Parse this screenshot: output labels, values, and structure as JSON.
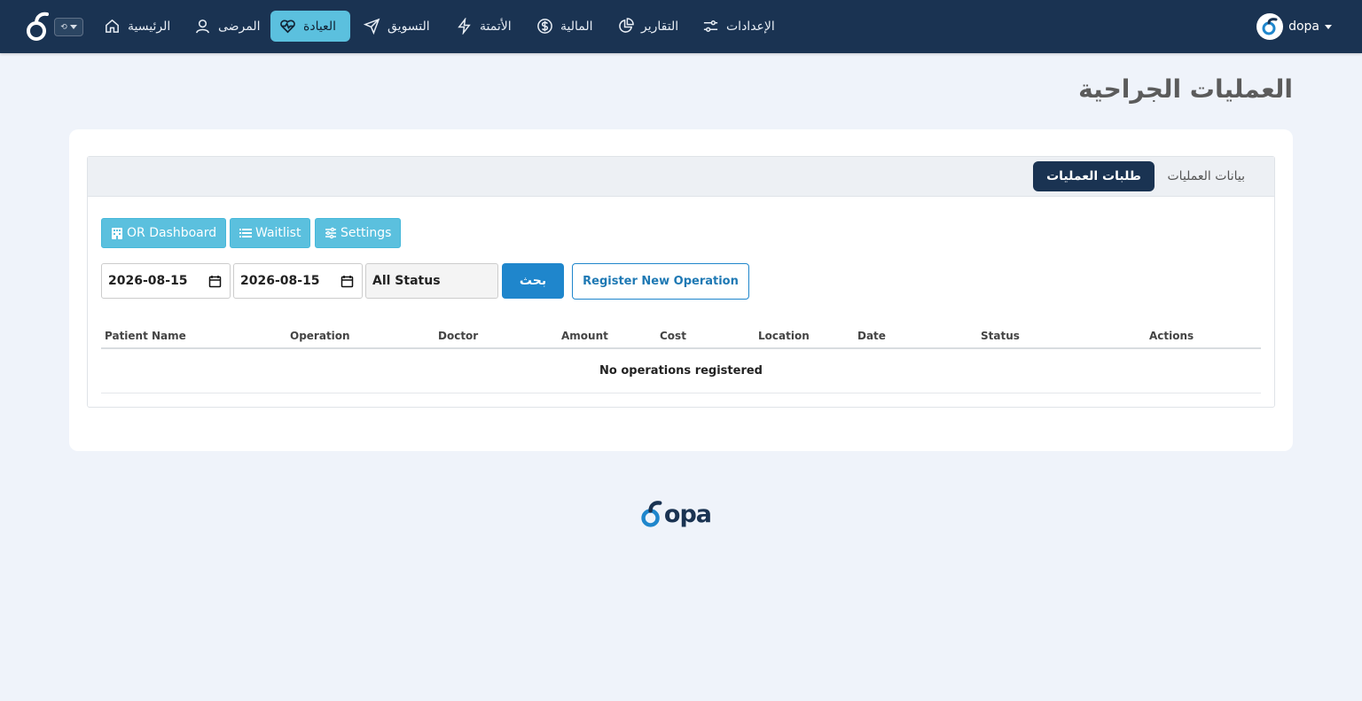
{
  "navbar": {
    "items": [
      {
        "label": "الإعدادات",
        "icon": "sliders-icon"
      },
      {
        "label": "التقارير",
        "icon": "pie-chart-icon"
      },
      {
        "label": "المالية",
        "icon": "dollar-circle-icon"
      },
      {
        "label": "الأتمتة",
        "icon": "lightning-icon"
      },
      {
        "label": "التسويق",
        "icon": "send-icon"
      },
      {
        "label": "العيادة",
        "icon": "heart-pulse-icon",
        "active": true
      },
      {
        "label": "المرضى",
        "icon": "user-icon"
      },
      {
        "label": "الرئيسية",
        "icon": "home-icon"
      }
    ],
    "user": {
      "name": "dopa"
    },
    "colors": {
      "background": "#1a3352",
      "active": "#5bc0de"
    }
  },
  "page": {
    "title": "العمليات الجراحية"
  },
  "tabs": [
    {
      "label": "طلبات العمليات",
      "active": true
    },
    {
      "label": "بيانات العمليات",
      "active": false
    }
  ],
  "toolbar": {
    "or_dashboard_label": "OR Dashboard",
    "waitlist_label": "Waitlist",
    "settings_label": "Settings"
  },
  "filters": {
    "date_from": "2026-08-15",
    "date_to": "2026-08-15",
    "status": "All Status",
    "search_label": "بحث",
    "register_label": "Register New Operation"
  },
  "table": {
    "columns": [
      "Patient Name",
      "Operation",
      "Doctor",
      "Amount",
      "Cost",
      "Location",
      "Date",
      "Status",
      "Actions"
    ],
    "rows": [],
    "empty_message": "No operations registered"
  },
  "footer": {
    "logo_text": "opa"
  }
}
